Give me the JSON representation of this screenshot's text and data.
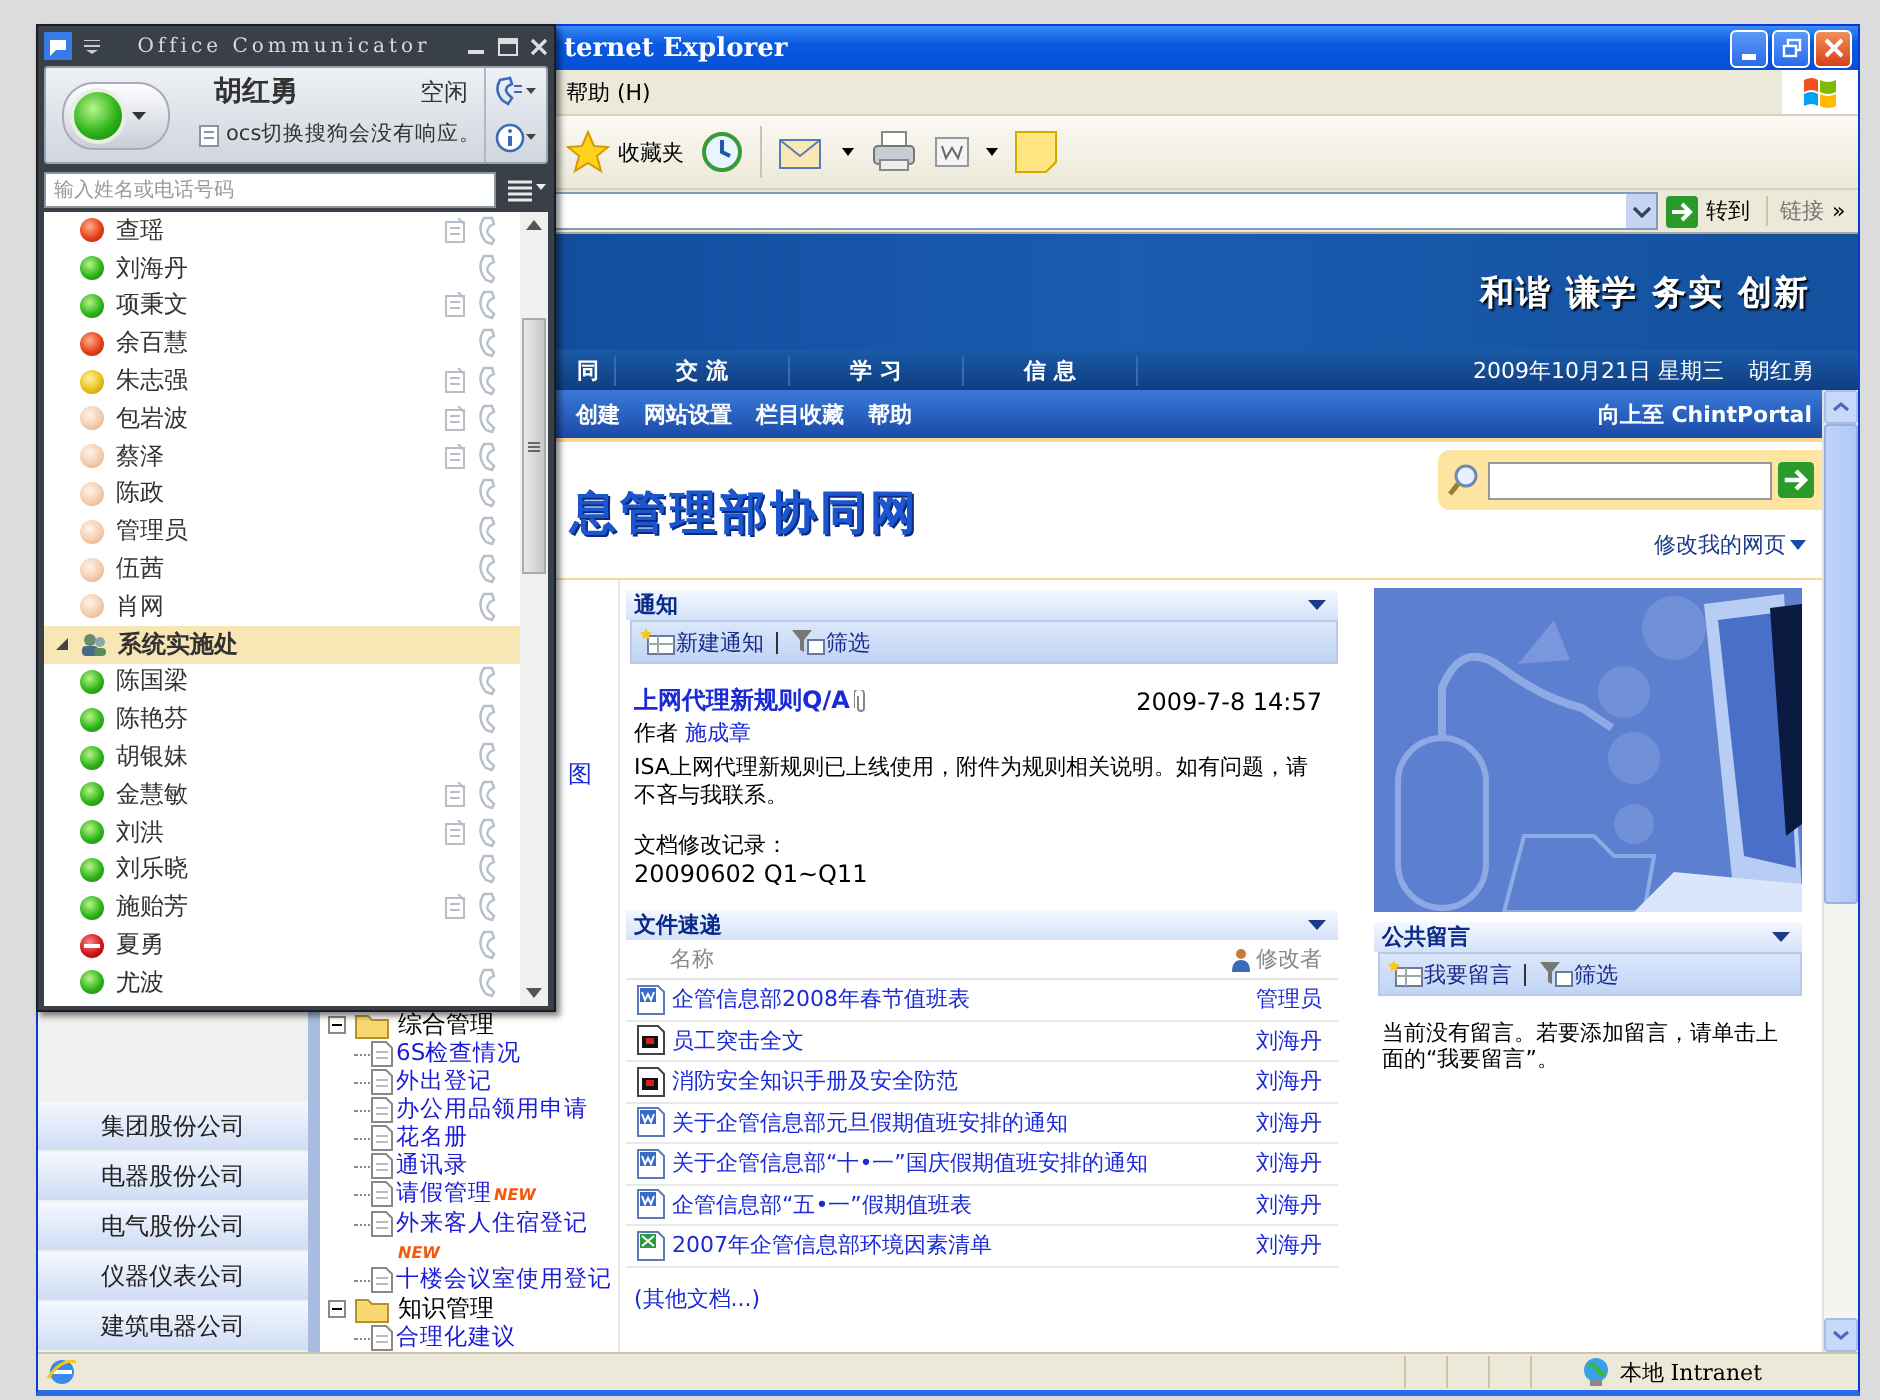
{
  "browser": {
    "title": "ternet Explorer",
    "menu": [
      "帮助 (H)"
    ],
    "toolbar": {
      "favorites": "收藏夹"
    },
    "address": {
      "go": "转到",
      "links": "链接",
      "more": "»"
    },
    "status": {
      "zone": "本地 Intranet"
    }
  },
  "site": {
    "slogan": "和谐 谦学 务实 创新",
    "nav": [
      "同",
      "交 流",
      "学 习",
      "信 息"
    ],
    "date": "2009年10月21日  星期三",
    "user": "胡红勇",
    "actions": [
      "创建",
      "网站设置",
      "栏目收藏",
      "帮助"
    ],
    "up": "向上至 ChintPortal",
    "title": "息管理部协同网",
    "edit_page": "修改我的网页"
  },
  "left": {
    "link": "图",
    "companies": [
      "集团股份公司",
      "电器股份公司",
      "电气股份公司",
      "仪器仪表公司",
      "建筑电器公司"
    ],
    "tree": [
      {
        "label": "综合管理",
        "expanded": true,
        "children": [
          {
            "label": "6S检查情况"
          },
          {
            "label": "外出登记"
          },
          {
            "label": "办公用品领用申请"
          },
          {
            "label": "花名册"
          },
          {
            "label": "通讯录"
          },
          {
            "label": "请假管理",
            "badge": "NEW"
          },
          {
            "label": "外来客人住宿登记",
            "badge": "NEW"
          },
          {
            "label": "十楼会议室使用登记"
          }
        ]
      },
      {
        "label": "知识管理",
        "expanded": true,
        "children": [
          {
            "label": "合理化建议"
          }
        ]
      }
    ]
  },
  "notice": {
    "title": "通知",
    "actions": [
      {
        "kind": "new",
        "label": "新建通知"
      },
      {
        "kind": "filter",
        "label": "筛选"
      }
    ],
    "post": {
      "title": "上网代理新规则Q/A",
      "attachment": true,
      "date": "2009-7-8 14:57",
      "author_label": "作者",
      "author": "施成章",
      "body": "ISA上网代理新规则已上线使用，附件为规则相关说明。如有问题，请不吝与我联系。",
      "log_label": "文档修改记录：",
      "log": "20090602  Q1~Q11"
    }
  },
  "files": {
    "title": "文件速递",
    "columns": [
      "名称",
      "修改者"
    ],
    "rows": [
      {
        "kind": "doc",
        "name": "企管信息部2008年春节值班表",
        "editor": "管理员"
      },
      {
        "kind": "pdf",
        "name": "员工突击全文",
        "editor": "刘海丹"
      },
      {
        "kind": "pdf",
        "name": "消防安全知识手册及安全防范",
        "editor": "刘海丹"
      },
      {
        "kind": "doc",
        "name": "关于企管信息部元旦假期值班安排的通知",
        "editor": "刘海丹"
      },
      {
        "kind": "doc",
        "name": "关于企管信息部“十•一”国庆假期值班安排的通知",
        "editor": "刘海丹"
      },
      {
        "kind": "doc",
        "name": "企管信息部“五•一”假期值班表",
        "editor": "刘海丹"
      },
      {
        "kind": "xls",
        "name": "2007年企管信息部环境因素清单",
        "editor": "刘海丹"
      }
    ],
    "more": "(其他文档...)"
  },
  "messages": {
    "title": "公共留言",
    "actions": [
      {
        "kind": "new",
        "label": "我要留言"
      },
      {
        "kind": "filter",
        "label": "筛选"
      }
    ],
    "text": "当前没有留言。若要添加留言，请单击上面的“我要留言”。"
  },
  "communicator": {
    "title": "Office Communicator",
    "user": {
      "name": "胡红勇",
      "status": "空闲",
      "kind": "online",
      "note": "ocs切换搜狗会没有响应。"
    },
    "search": {
      "placeholder": "输入姓名或电话号码"
    },
    "groups": [
      {
        "contacts": [
          {
            "name": "查瑶",
            "kind": "busy",
            "note": true
          },
          {
            "name": "刘海丹",
            "kind": "online",
            "note": false
          },
          {
            "name": "项秉文",
            "kind": "online",
            "note": true
          },
          {
            "name": "余百慧",
            "kind": "busy",
            "note": false
          },
          {
            "name": "朱志强",
            "kind": "away",
            "note": true
          },
          {
            "name": "包岩波",
            "kind": "offline",
            "note": true
          },
          {
            "name": "蔡泽",
            "kind": "offline",
            "note": true
          },
          {
            "name": "陈政",
            "kind": "offline",
            "note": false
          },
          {
            "name": "管理员",
            "kind": "offline",
            "note": false
          },
          {
            "name": "伍茜",
            "kind": "offline",
            "note": false
          },
          {
            "name": "肖网",
            "kind": "offline",
            "note": false
          }
        ]
      },
      {
        "name": "系统实施处",
        "expanded": true,
        "contacts": [
          {
            "name": "陈国梁",
            "kind": "online",
            "note": false
          },
          {
            "name": "陈艳芬",
            "kind": "online",
            "note": false
          },
          {
            "name": "胡银妹",
            "kind": "online",
            "note": false
          },
          {
            "name": "金慧敏",
            "kind": "online",
            "note": true
          },
          {
            "name": "刘洪",
            "kind": "online",
            "note": true
          },
          {
            "name": "刘乐晓",
            "kind": "online",
            "note": false
          },
          {
            "name": "施贻芳",
            "kind": "online",
            "note": true
          },
          {
            "name": "夏勇",
            "kind": "dnd",
            "note": false
          },
          {
            "name": "尤波",
            "kind": "online",
            "note": false
          }
        ]
      }
    ]
  }
}
